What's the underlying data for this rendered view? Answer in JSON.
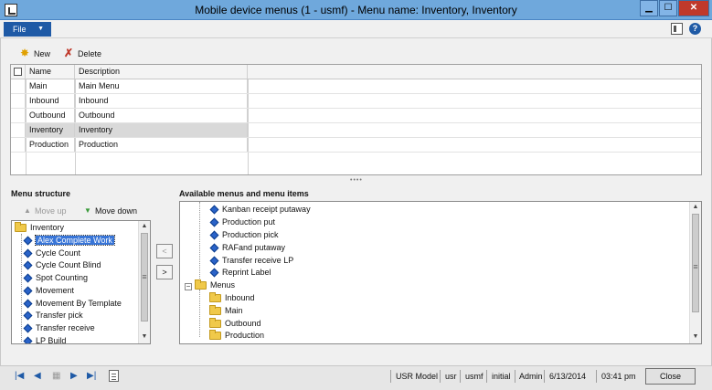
{
  "window": {
    "title": "Mobile device menus (1 - usmf) - Menu name: Inventory, Inventory",
    "buttons": {
      "minimize": "▁",
      "maximize": "☐",
      "close": "✕"
    }
  },
  "menubar": {
    "file_label": "File",
    "icons": [
      "layout-icon",
      "help-icon"
    ],
    "help_glyph": "?"
  },
  "toolbar": {
    "new_label": "New",
    "delete_label": "Delete",
    "icons": {
      "new": "new-star-icon",
      "delete": "delete-x-icon"
    }
  },
  "grid": {
    "columns": [
      "Name",
      "Description"
    ],
    "rows": [
      {
        "name": "Main",
        "description": "Main Menu",
        "selected": false
      },
      {
        "name": "Inbound",
        "description": "Inbound",
        "selected": false
      },
      {
        "name": "Outbound",
        "description": "Outbound",
        "selected": false
      },
      {
        "name": "Inventory",
        "description": "Inventory",
        "selected": true
      },
      {
        "name": "Production",
        "description": "Production",
        "selected": false
      }
    ]
  },
  "menu_structure": {
    "label": "Menu structure",
    "move_up_label": "Move up",
    "move_down_label": "Move down",
    "root": "Inventory",
    "items": [
      {
        "label": "Alex Complete Work",
        "selected": true
      },
      {
        "label": "Cycle Count",
        "selected": false
      },
      {
        "label": "Cycle Count Blind",
        "selected": false
      },
      {
        "label": "Spot Counting",
        "selected": false
      },
      {
        "label": "Movement",
        "selected": false
      },
      {
        "label": "Movement By Template",
        "selected": false
      },
      {
        "label": "Transfer pick",
        "selected": false
      },
      {
        "label": "Transfer receive",
        "selected": false
      },
      {
        "label": "LP Build",
        "selected": false
      }
    ]
  },
  "transfer_buttons": {
    "remove": "<",
    "add": ">"
  },
  "available": {
    "label": "Available menus and menu items",
    "menu_items": [
      "Kanban receipt putaway",
      "Production put",
      "Production pick",
      "RAFand putaway",
      "Transfer receive LP",
      "Reprint Label"
    ],
    "menus_folder": "Menus",
    "menus": [
      "Inbound",
      "Main",
      "Outbound",
      "Production"
    ]
  },
  "status": {
    "nav_icons": [
      "first-record-icon",
      "previous-record-icon",
      "grid-icon",
      "next-record-icon",
      "last-record-icon",
      "note-icon"
    ],
    "model": "USR Model",
    "user": "usr",
    "company": "usmf",
    "layer": "initial",
    "role": "Admin",
    "date": "6/13/2014",
    "time": "03:41 pm",
    "close_label": "Close"
  },
  "colors": {
    "titlebar": "#6fa8dc",
    "file_button": "#1f5aa6",
    "selection": "#3875d7",
    "row_selected": "#d9d9d9"
  }
}
